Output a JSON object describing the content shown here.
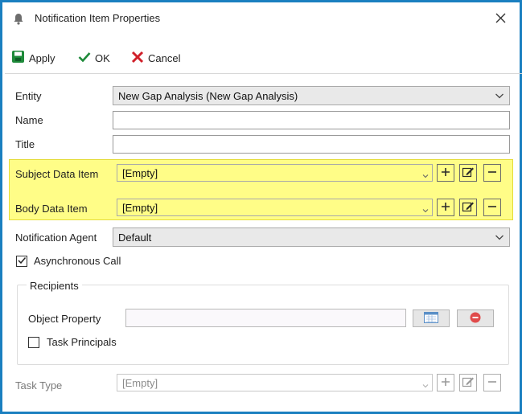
{
  "dialog": {
    "title": "Notification Item Properties",
    "accent_color": "#1a7fc0"
  },
  "toolbar": {
    "apply_label": "Apply",
    "ok_label": "OK",
    "cancel_label": "Cancel"
  },
  "fields": {
    "entity": {
      "label": "Entity",
      "value": "New Gap Analysis (New Gap Analysis)"
    },
    "name": {
      "label": "Name",
      "value": ""
    },
    "title": {
      "label": "Title",
      "value": ""
    },
    "subject_data_item": {
      "label": "Subject Data Item",
      "value": "[Empty]"
    },
    "body_data_item": {
      "label": "Body Data Item",
      "value": "[Empty]"
    },
    "notification_agent": {
      "label": "Notification Agent",
      "value": "Default"
    },
    "asynchronous_call": {
      "label": "Asynchronous Call",
      "checked": true
    }
  },
  "recipients": {
    "group_title": "Recipients",
    "object_property_label": "Object Property",
    "object_property_value": "",
    "task_principals_label": "Task Principals",
    "task_principals_checked": false
  },
  "task_type": {
    "label": "Task Type",
    "value": "[Empty]"
  },
  "colors": {
    "highlight": "#fffd87",
    "apply_icon": "#1e8a3a",
    "ok_icon": "#1e8a3a",
    "cancel_icon": "#d0202a"
  }
}
